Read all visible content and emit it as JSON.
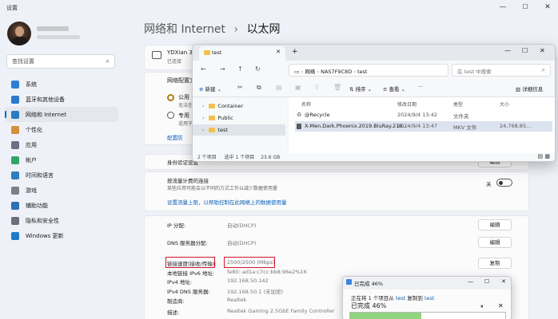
{
  "window": {
    "title": "设置",
    "min": "—",
    "max": "☐",
    "close": "✕"
  },
  "search": {
    "placeholder": "查找设置"
  },
  "nav": [
    {
      "label": "系统",
      "color": "#2f7fd0"
    },
    {
      "label": "蓝牙和其他设备",
      "color": "#2a78c8"
    },
    {
      "label": "网络和 Internet",
      "color": "#2c79c4"
    },
    {
      "label": "个性化",
      "color": "#d98c3b"
    },
    {
      "label": "应用",
      "color": "#6d6f86"
    },
    {
      "label": "帐户",
      "color": "#2fa46a"
    },
    {
      "label": "时间和语言",
      "color": "#2e7ec2"
    },
    {
      "label": "游戏",
      "color": "#7a7f8a"
    },
    {
      "label": "辅助功能",
      "color": "#2b6fb8"
    },
    {
      "label": "隐私和安全性",
      "color": "#6b6f7a"
    },
    {
      "label": "Windows 更新",
      "color": "#1f78c8"
    }
  ],
  "breadcrumb": {
    "parent": "网络和 Internet",
    "sep": "›",
    "current": "以太网"
  },
  "adapter": {
    "name": "YDXian 3",
    "status": "已连接"
  },
  "profile": {
    "header": "网络配置文",
    "public": "公用",
    "public_desc": "无法在",
    "private": "专用",
    "private_desc": "适用于",
    "firewall": "配置防"
  },
  "auth": {
    "label": "身份验证设置",
    "edit": "编辑"
  },
  "metered": {
    "label": "按流量计费的连接",
    "desc": "某些应用可能会以不同的方式工作以减少数据使用量",
    "toggle_label": "关",
    "link": "设置流量上限，以帮助控制在此网络上的数据使用量"
  },
  "details": [
    {
      "label": "IP 分配:",
      "value": "自动(DHCP)",
      "button": "编辑"
    },
    {
      "label": "DNS 服务器分配:",
      "value": "自动(DHCP)",
      "button": "编辑"
    },
    {
      "label": "链接速度(接收/传输):",
      "value": "2500/2500 (Mbps)",
      "button": "复制"
    },
    {
      "label": "本地链接 IPv6 地址:",
      "value": "fe80::ad1a:c7cc:bb8:96e2%16"
    },
    {
      "label": "IPv4 地址:",
      "value": "192.168.50.142"
    },
    {
      "label": "IPv4 DNS 服务器:",
      "value": "192.168.50.1 (未加密)"
    },
    {
      "label": "制造商:",
      "value": "Realtek"
    },
    {
      "label": "描述:",
      "value": "Realtek Gaming 2.5GbE Family Controller"
    }
  ],
  "explorer": {
    "tab": "test",
    "new_tab": "+",
    "path": [
      "网络",
      "NAS7F9C8D",
      "test"
    ],
    "search_placeholder": "在 test 中搜索",
    "toolbar": {
      "new": "新建",
      "sort": "排序",
      "view": "查看",
      "more": "···",
      "details": "详细信息"
    },
    "tree": [
      "Container",
      "Public",
      "test"
    ],
    "columns": [
      "名称",
      "修改日期",
      "类型",
      "大小"
    ],
    "files": [
      {
        "name": "@Recycle",
        "date": "2024/9/4 13:42",
        "type": "文件夹",
        "size": ""
      },
      {
        "name": "X-Men.Dark.Phoenix.2019.BluRay.216...",
        "date": "2024/9/4 13:47",
        "type": "MKV 文件",
        "size": "24,768,85..."
      }
    ],
    "status": {
      "count": "2 个项目",
      "selected": "选中 1 个项目",
      "size": "23.6 GB"
    }
  },
  "copy": {
    "title": "已完成 46%",
    "desc_prefix": "正在将 1 个项目从",
    "src": "test",
    "desc_mid": "复制到",
    "dst": "test",
    "percent_label": "已完成 46%",
    "progress": 0.46
  }
}
